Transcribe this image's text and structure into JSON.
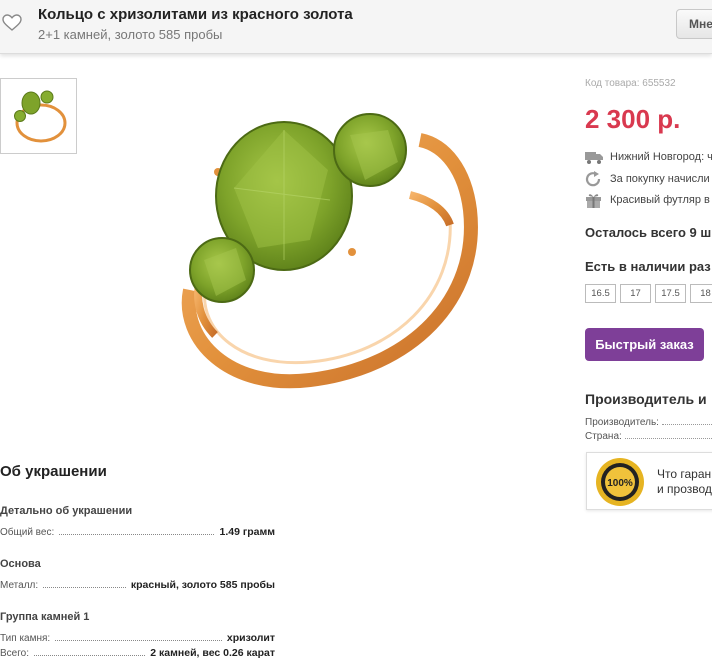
{
  "header": {
    "title": "Кольцо с хризолитами из красного золота",
    "subtitle": "2+1 камней, золото 585 пробы",
    "more_button": "Мне"
  },
  "product": {
    "sku": "Код товара: 655532",
    "price": "2 300 р.",
    "info": [
      {
        "icon": "truck-icon",
        "text": "Нижний Новгород: ч"
      },
      {
        "icon": "refresh-icon",
        "text": "За покупку начисли"
      },
      {
        "icon": "gift-icon",
        "text": "Красивый футляр в"
      }
    ],
    "remaining": "Осталось всего 9 ш",
    "availability_title": "Есть в наличии раз",
    "sizes": [
      "16.5",
      "17",
      "17.5",
      "18"
    ],
    "quick_order": "Быстрый заказ",
    "maker_title": "Производитель и",
    "maker_rows": [
      {
        "label": "Производитель:"
      },
      {
        "label": "Страна:"
      }
    ],
    "guarantee": {
      "line1": "Что гаран",
      "line2": "и прозвод",
      "seal_text": "100%"
    }
  },
  "details": {
    "title": "Об украшении",
    "groups": [
      {
        "title": "Детально об украшении",
        "rows": [
          {
            "label": "Общий вес:",
            "value": "1.49 грамм"
          }
        ]
      },
      {
        "title": "Основа",
        "rows": [
          {
            "label": "Металл:",
            "value": "красный, золото 585 пробы"
          }
        ]
      },
      {
        "title": "Группа камней 1",
        "rows": [
          {
            "label": "Тип камня:",
            "value": "хризолит"
          },
          {
            "label": "Всего:",
            "value": "2 камней, вес 0.26 карат"
          }
        ]
      }
    ]
  },
  "colors": {
    "price": "#d9394f",
    "button": "#7e3f98",
    "gem": "#7ea32a",
    "gold": "#e2913c"
  }
}
